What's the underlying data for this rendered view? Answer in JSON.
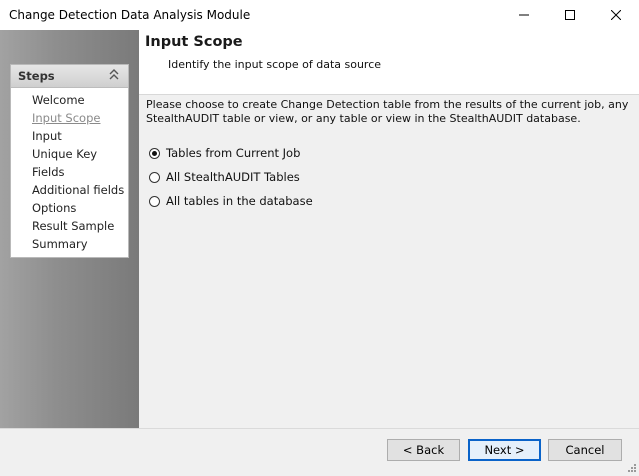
{
  "window": {
    "title": "Change Detection Data Analysis Module",
    "controls": {
      "minimize_icon": "minimize-icon",
      "maximize_icon": "maximize-icon",
      "close_icon": "close-icon"
    }
  },
  "sidebar": {
    "header": "Steps",
    "collapse_icon": "double-chevron-up-icon",
    "items": [
      {
        "label": "Welcome"
      },
      {
        "label": "Input Scope"
      },
      {
        "label": "Input"
      },
      {
        "label": "Unique Key"
      },
      {
        "label": "Fields"
      },
      {
        "label": "Additional fields"
      },
      {
        "label": "Options"
      },
      {
        "label": "Result Sample"
      },
      {
        "label": "Summary"
      }
    ],
    "active_index": 1
  },
  "page": {
    "title": "Input Scope",
    "subtitle": "Identify the input scope of data source",
    "description": "Please choose to create Change Detection table from the results of the current job, any StealthAUDIT table or view, or any table or view in the StealthAUDIT database."
  },
  "options": [
    {
      "label": "Tables from Current Job",
      "checked": true
    },
    {
      "label": "All StealthAUDIT Tables",
      "checked": false
    },
    {
      "label": "All tables in the database",
      "checked": false
    }
  ],
  "footer": {
    "back_label": "< Back",
    "next_label": "Next >",
    "cancel_label": "Cancel"
  },
  "colors": {
    "focus_border": "#0a63c9",
    "sidebar_gradient_dark": "#7a7a7a",
    "sidebar_gradient_light": "#a2a2a2"
  }
}
